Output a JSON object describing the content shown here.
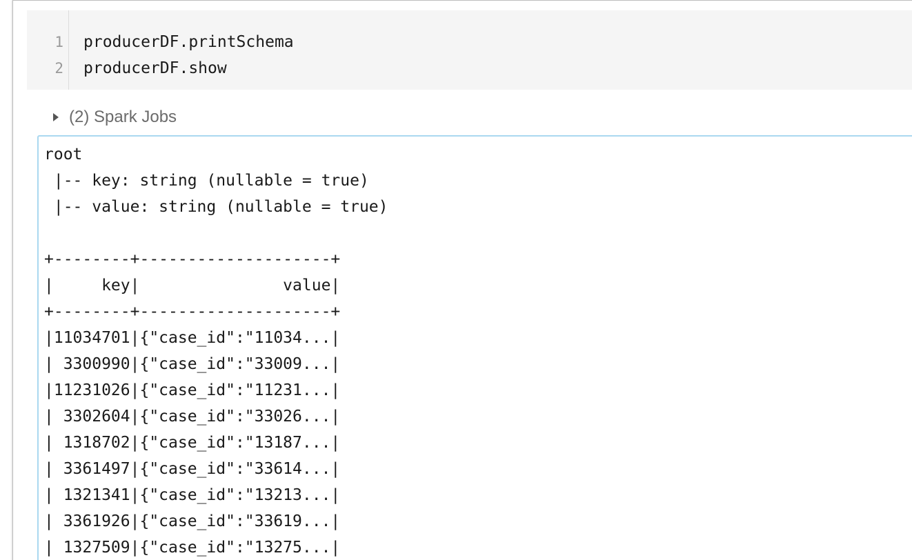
{
  "editor": {
    "lines": [
      {
        "number": "1",
        "code": "producerDF.printSchema"
      },
      {
        "number": "2",
        "code": "producerDF.show"
      }
    ]
  },
  "spark_jobs": {
    "label": "(2) Spark Jobs"
  },
  "output": {
    "lines": [
      "root",
      " |-- key: string (nullable = true)",
      " |-- value: string (nullable = true)",
      "",
      "+--------+--------------------+",
      "|     key|               value|",
      "+--------+--------------------+",
      "|11034701|{\"case_id\":\"11034...|",
      "| 3300990|{\"case_id\":\"33009...|",
      "|11231026|{\"case_id\":\"11231...|",
      "| 3302604|{\"case_id\":\"33026...|",
      "| 1318702|{\"case_id\":\"13187...|",
      "| 3361497|{\"case_id\":\"33614...|",
      "| 1321341|{\"case_id\":\"13213...|",
      "| 3361926|{\"case_id\":\"33619...|",
      "| 1327509|{\"case_id\":\"13275...|"
    ]
  }
}
